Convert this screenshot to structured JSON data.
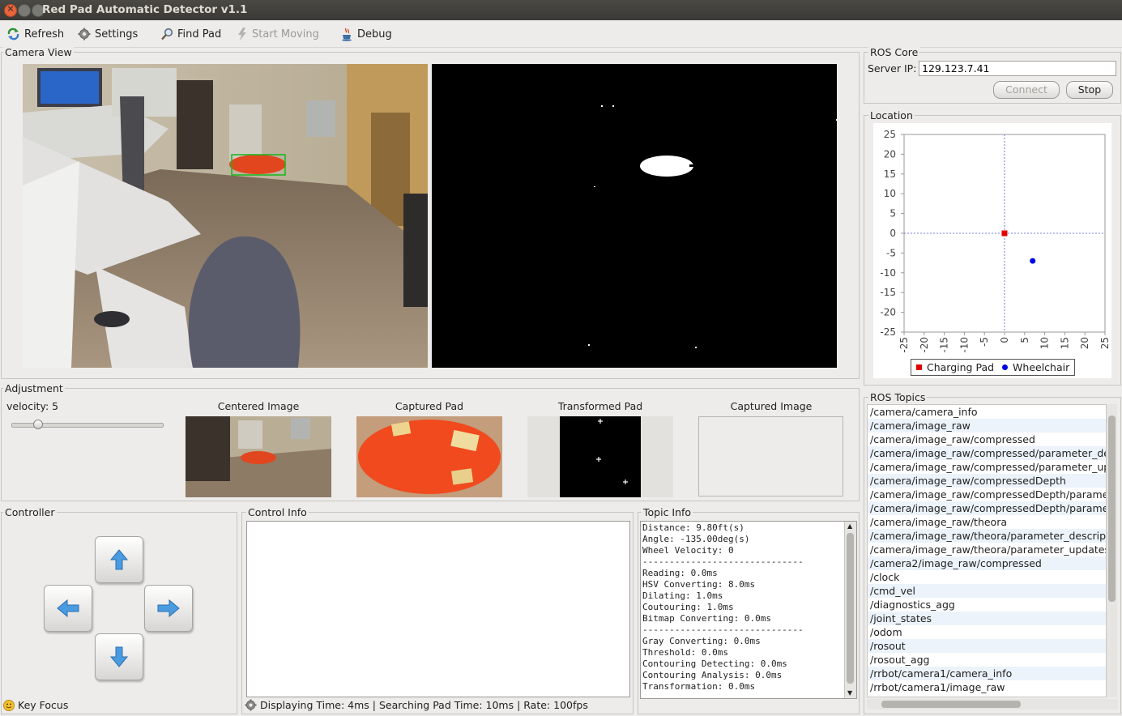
{
  "window": {
    "title": "Red Pad Automatic Detector v1.1"
  },
  "toolbar": {
    "refresh": "Refresh",
    "settings": "Settings",
    "find_pad": "Find Pad",
    "start_moving": "Start Moving",
    "debug": "Debug"
  },
  "camera_view": {
    "label": "Camera View"
  },
  "ros_core": {
    "label": "ROS Core",
    "server_ip_label": "Server IP:",
    "server_ip": "129.123.7.41",
    "connect": "Connect",
    "stop": "Stop"
  },
  "location": {
    "label": "Location",
    "legend_pad": "Charging Pad",
    "legend_wheelchair": "Wheelchair",
    "colors": {
      "pad": "#e00000",
      "wheelchair": "#0000e0"
    }
  },
  "chart_data": {
    "type": "scatter",
    "xlim": [
      -25,
      25
    ],
    "ylim": [
      -25,
      25
    ],
    "xticks": [
      "-25",
      "-20",
      "-15",
      "-10",
      "-5",
      "0",
      "5",
      "10",
      "15",
      "20",
      "25"
    ],
    "yticks": [
      "25",
      "20",
      "15",
      "10",
      "5",
      "0",
      "-5",
      "-10",
      "-15",
      "-20",
      "-25"
    ],
    "series": [
      {
        "name": "Charging Pad",
        "marker": "square",
        "color": "#e00000",
        "points": [
          [
            0,
            0
          ]
        ]
      },
      {
        "name": "Wheelchair",
        "marker": "circle",
        "color": "#0000e0",
        "points": [
          [
            7,
            -7
          ]
        ]
      }
    ],
    "crosshair": true
  },
  "adjustment": {
    "label": "Adjustment",
    "velocity_label": "velocity: 5",
    "velocity": 5,
    "thumbs": [
      "Centered Image",
      "Captured Pad",
      "Transformed Pad",
      "Captured Image"
    ]
  },
  "ros_topics": {
    "label": "ROS Topics",
    "items": [
      "/camera/camera_info",
      "/camera/image_raw",
      "/camera/image_raw/compressed",
      "/camera/image_raw/compressed/parameter_de",
      "/camera/image_raw/compressed/parameter_up",
      "/camera/image_raw/compressedDepth",
      "/camera/image_raw/compressedDepth/parame",
      "/camera/image_raw/compressedDepth/parame",
      "/camera/image_raw/theora",
      "/camera/image_raw/theora/parameter_descript",
      "/camera/image_raw/theora/parameter_updates",
      "/camera2/image_raw/compressed",
      "/clock",
      "/cmd_vel",
      "/diagnostics_agg",
      "/joint_states",
      "/odom",
      "/rosout",
      "/rosout_agg",
      "/rrbot/camera1/camera_info",
      "/rrbot/camera1/image_raw"
    ]
  },
  "controller": {
    "label": "Controller",
    "key_focus": "Key Focus"
  },
  "control_info": {
    "label": "Control Info",
    "status": "Displaying Time: 4ms | Searching Pad Time: 10ms | Rate: 100fps"
  },
  "topic_info": {
    "label": "Topic Info",
    "text": "Distance: 9.80ft(s)\nAngle: -135.00deg(s)\nWheel Velocity: 0\n------------------------------\nReading: 0.0ms\nHSV Converting: 8.0ms\nDilating: 1.0ms\nCoutouring: 1.0ms\nBitmap Converting: 0.0ms\n------------------------------\nGray Converting: 0.0ms\nThreshold: 0.0ms\nContouring Detecting: 0.0ms\nContouring Analysis: 0.0ms\nTransformation: 0.0ms"
  }
}
